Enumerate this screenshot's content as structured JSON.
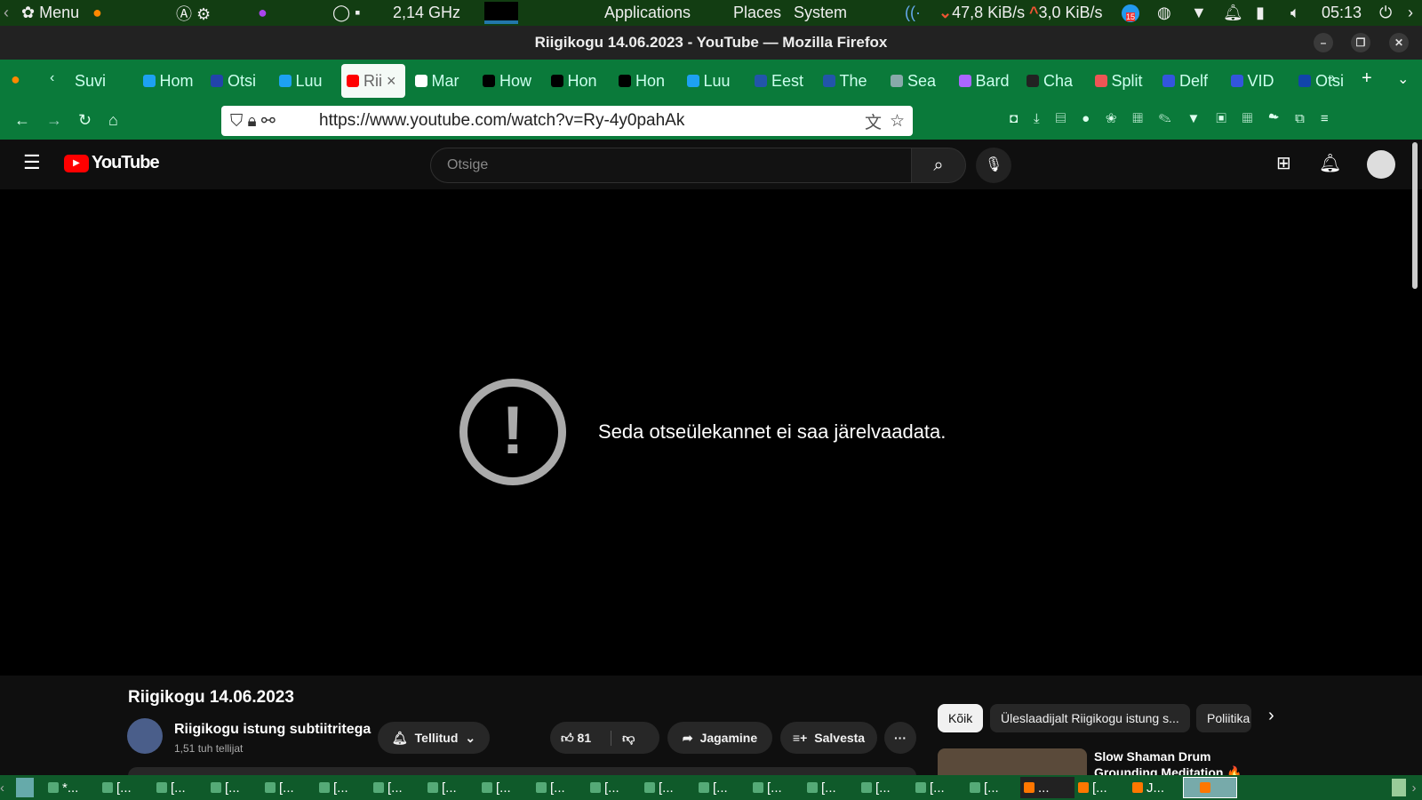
{
  "panel": {
    "menu": "Menu",
    "cpu": "2,14 GHz",
    "applications": "Applications",
    "places": "Places",
    "system": "System",
    "net_down": "47,8 KiB/s",
    "net_up": "3,0 KiB/s",
    "badge": "15",
    "clock": "05:13"
  },
  "window": {
    "title": "Riigikogu 14.06.2023 - YouTube — Mozilla Firefox"
  },
  "tabs": [
    {
      "label": "Suvi",
      "icon": "generic"
    },
    {
      "label": "Hom",
      "icon": "twitter"
    },
    {
      "label": "Otsi",
      "icon": "grid"
    },
    {
      "label": "Luu",
      "icon": "twitter"
    },
    {
      "label": "Rii",
      "icon": "youtube"
    },
    {
      "label": "Mar",
      "icon": "wikipedia"
    },
    {
      "label": "How",
      "icon": "r"
    },
    {
      "label": "Hon",
      "icon": "r"
    },
    {
      "label": "Hon",
      "icon": "r"
    },
    {
      "label": "Luu",
      "icon": "twitter"
    },
    {
      "label": "Eest",
      "icon": "rt"
    },
    {
      "label": "The",
      "icon": "rt"
    },
    {
      "label": "Sea",
      "icon": "openai"
    },
    {
      "label": "Bard",
      "icon": "bard"
    },
    {
      "label": "Cha",
      "icon": "w"
    },
    {
      "label": "Split",
      "icon": "wrench"
    },
    {
      "label": "Delf",
      "icon": "d"
    },
    {
      "label": "VID",
      "icon": "d"
    },
    {
      "label": "Otsi",
      "icon": "wave"
    }
  ],
  "nav": {
    "url": "https://www.youtube.com/watch?v=Ry-4y0pahAk"
  },
  "youtube": {
    "logo": "YouTube",
    "search_placeholder": "Otsige",
    "error": "Seda otseülekannet ei saa järelvaadata.",
    "video_title": "Riigikogu 14.06.2023",
    "channel": "Riigikogu istung subtiitritega",
    "subs": "1,51 tuh tellijat",
    "subscribed": "Tellitud",
    "likes": "81",
    "share": "Jagamine",
    "save": "Salvesta",
    "chips": [
      "Kõik",
      "Üleslaadijalt Riigikogu istung s...",
      "Poliitika"
    ],
    "rec_title": "Slow Shaman Drum Grounding Meditation 🔥 Air&Fire : Focus"
  },
  "taskbar": [
    "*...",
    "[...",
    "[...",
    "[...",
    "[...",
    "[...",
    "[...",
    "[...",
    "[...",
    "[...",
    "[...",
    "[...",
    "[...",
    "[...",
    "[...",
    "[...",
    "[...",
    "[...",
    "...",
    "[...",
    "J..."
  ]
}
